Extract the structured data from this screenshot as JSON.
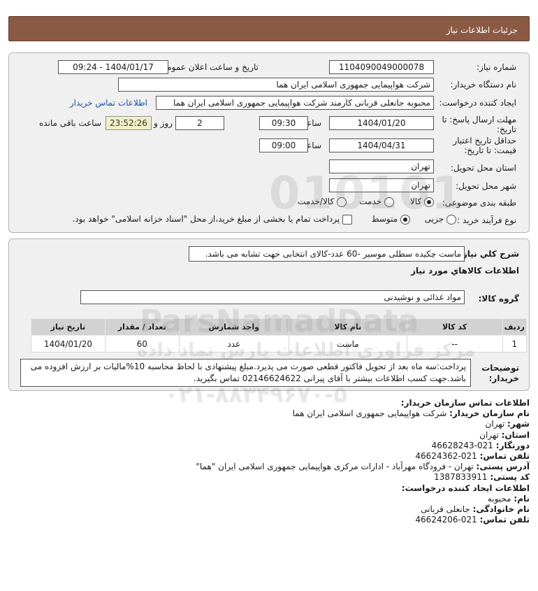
{
  "header": {
    "title": "جزئیات اطلاعات نیاز"
  },
  "details": {
    "need_number_label": "شماره نیاز:",
    "need_number": "1104090049000078",
    "announce_label": "تاریخ و ساعت اعلان عمومی:",
    "announce_value": "1404/01/17 - 09:24",
    "buyer_org_label": "نام دستگاه خریدار:",
    "buyer_org": "شرکت هواپیمایی جمهوری اسلامی ایران هما",
    "creator_label": "ایجاد کننده درخواست:",
    "creator": "محبوبه جانعلی قربانی کارمند شرکت هواپیمایی جمهوری اسلامی ایران هما",
    "contact_link": "اطلاعات تماس خریدار",
    "deadline_label_1": "مهلت ارسال پاسخ: تا",
    "deadline_label_2": "تاریخ:",
    "deadline_date": "1404/01/20",
    "time_label": "ساعت",
    "deadline_time": "09:30",
    "days_value": "2",
    "days_label": "روز و",
    "remaining_time": "23:52:26",
    "remaining_label": "ساعت باقی مانده",
    "validity_label_1": "حداقل تاریخ اعتبار",
    "validity_label_2": "قیمت: تا تاریخ:",
    "validity_date": "1404/04/31",
    "validity_time": "09:00",
    "province_label": "استان محل تحویل:",
    "province": "تهران",
    "city_label": "شهر محل تحویل:",
    "city": "تهران",
    "category_label": "طبقه بندی موضوعی:",
    "category_options": [
      "کالا",
      "خدمت",
      "کالا/خدمت"
    ],
    "category_selected": "کالا",
    "process_label": "نوع فرآیند خرید :",
    "process_options": [
      "جزیی",
      "متوسط"
    ],
    "process_selected": "متوسط",
    "treasury_note": "پرداخت تمام یا بخشی از مبلغ خرید،از محل \"اسناد خزانه اسلامی\" خواهد بود."
  },
  "need": {
    "summary_label": "شرح کلي نياز:",
    "summary": "ماست چکیده سطلی موسیر -60 عدد-کالای انتخابی جهت تشابه می باشد.",
    "goods_info_label": "اطلاعات کالاهاي مورد نياز",
    "group_label": "گروه کالا:",
    "group_value": "مواد غذائی و نوشیدنی",
    "table_headers": [
      "ردیف",
      "کد کالا",
      "نام کالا",
      "واحد شمارش",
      "تعداد / مقدار",
      "تاریخ نیاز"
    ],
    "table_rows": [
      [
        "1",
        "--",
        "ماست",
        "عدد",
        "60",
        "1404/01/20"
      ]
    ],
    "buyer_notes_label": "توضیحات خریدار:",
    "buyer_notes": "پرداخت:سه ماه بعد از تحویل فاکتور قطعی صورت می پذیرد.مبلغ پیشنهادی با لحاظ محاسبه 10%مالیات بر ارزش افزوده می باشد.جهت کسب اطلاعات بیشتر با آقای پیرانی 02146624622 تماس بگیرید."
  },
  "contact": {
    "section_title": "اطلاعات تماس سازمان خریدار:",
    "rows": [
      {
        "k": "نام سازمان خریدار:",
        "v": " شرکت هواپیمایی جمهوری اسلامی ایران هما"
      },
      {
        "k": "شهر:",
        "v": " تهران"
      },
      {
        "k": "استان:",
        "v": " تهران"
      },
      {
        "k": "دورنگار:",
        "v": " 021-46628243"
      },
      {
        "k": "تلفن تماس:",
        "v": " 021-46624362"
      },
      {
        "k": "آدرس پستی:",
        "v": " تهران - فرودگاه مهرآباد - ادارات مرکزی هواپیمایی جمهوری اسلامی ایران \"هما\""
      },
      {
        "k": "کد پستی:",
        "v": " 1387833911"
      }
    ],
    "creator_title": "اطلاعات ایجاد کننده درخواست:",
    "creator_rows": [
      {
        "k": "نام:",
        "v": " محبوبه"
      },
      {
        "k": "نام خانوادگی:",
        "v": " جانعلی قربانی"
      },
      {
        "k": "تلفن تماس:",
        "v": " 021-46624206"
      }
    ]
  },
  "watermark": {
    "line1": "ParsNamadData",
    "line2": "مرکز فراوری اطلاعات پارس نماد داده",
    "line3": "۰۲۱-۸۸۳۴۹۶۷۰-۵",
    "digits": "010101"
  }
}
